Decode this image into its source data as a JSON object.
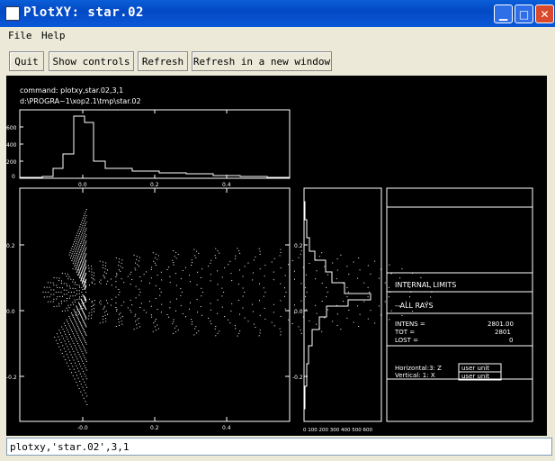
{
  "window": {
    "title": "PlotXY: star.02"
  },
  "menu": {
    "file": "File",
    "help": "Help"
  },
  "toolbar": {
    "quit": "Quit",
    "show_controls": "Show controls",
    "refresh": "Refresh",
    "refresh_new": "Refresh in a new window"
  },
  "plot": {
    "command": "command: plotxy,star.02,3,1",
    "path": "d:\\PROGRA~1\\xop2.1\\tmp\\star.02",
    "top_hist_yticks": [
      "600",
      "400",
      "200",
      "0"
    ],
    "top_hist_xticks": [
      "0.0",
      "0.2",
      "0.4"
    ],
    "main_xticks": [
      "-0.0",
      "0.2",
      "0.4"
    ],
    "main_yticks": [
      "0.2",
      "0.0",
      "-0.2"
    ],
    "side_hist_yticks": [
      "0.2",
      "0.0",
      "-0.2"
    ],
    "side_hist_xticks": "0 100 200 300 400 500 600",
    "info": {
      "internal_limits": "INTERNAL LIMITS",
      "all_rays": "--ALL RAYS",
      "intens_label": "INTENS =",
      "intens_value": "2801.00",
      "tot_label": "TOT =",
      "tot_value": "2801",
      "lost_label": "LOST =",
      "lost_value": "0",
      "horizontal": "Horizontal:3: Z",
      "vertical": "Vertical:  1: X",
      "unit": "user unit"
    }
  },
  "command_line": {
    "value": "plotxy,'star.02',3,1"
  }
}
